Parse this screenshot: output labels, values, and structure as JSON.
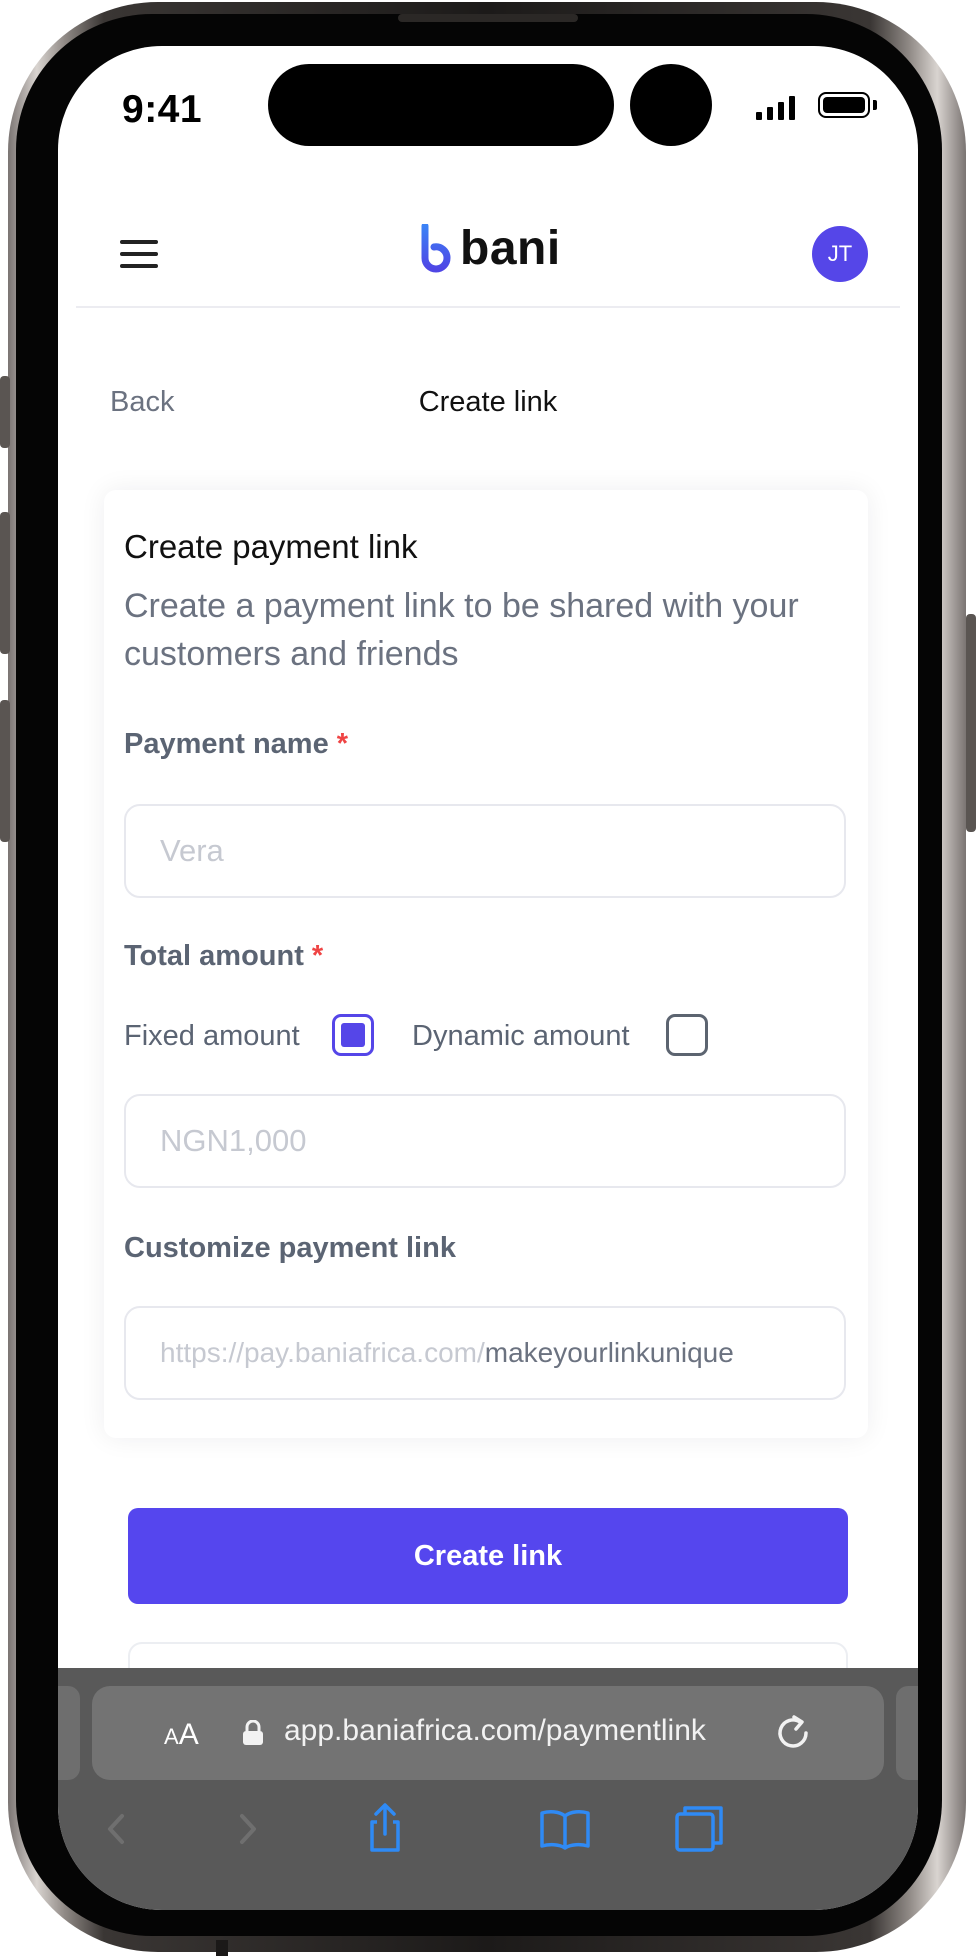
{
  "status_bar": {
    "time": "9:41"
  },
  "header": {
    "brand": "bani",
    "avatar_initials": "JT"
  },
  "nav": {
    "back_label": "Back",
    "page_title": "Create link"
  },
  "form": {
    "title": "Create payment link",
    "description": "Create a payment link to be shared with your customers and friends",
    "payment_name": {
      "label": "Payment name",
      "required_mark": "*",
      "placeholder": "Vera"
    },
    "total_amount": {
      "label": "Total amount",
      "required_mark": "*",
      "options": [
        {
          "label": "Fixed amount",
          "checked": true
        },
        {
          "label": "Dynamic amount",
          "checked": false
        }
      ],
      "placeholder": "NGN1,000"
    },
    "custom_link": {
      "label": "Customize payment link",
      "prefix": "https://pay.baniafrica.com/",
      "suffix": "makeyourlinkunique"
    },
    "submit_label": "Create link"
  },
  "browser": {
    "text_size_small": "A",
    "text_size_large": "A",
    "url": "app.baniafrica.com/paymentlink",
    "icons": [
      "back-icon",
      "forward-icon",
      "share-icon",
      "bookmarks-icon",
      "tabs-icon"
    ]
  },
  "colors": {
    "accent": "#5546EE",
    "required": "#EF4444",
    "muted_text": "#6B7280",
    "safari_bar": "#595959",
    "safari_icon": "#2F8AF5"
  }
}
